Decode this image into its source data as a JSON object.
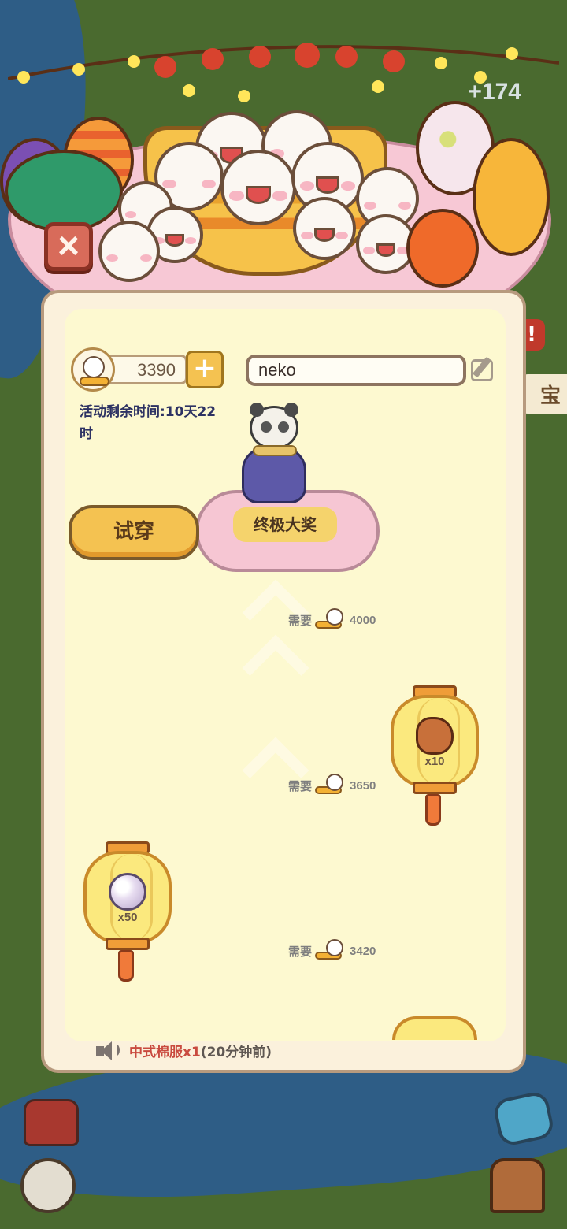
{
  "background": {
    "plus_counter": "+174",
    "side_label": "宝",
    "side_alert": "!"
  },
  "currency": {
    "icon": "tangyuan-coin-icon",
    "amount": "3390",
    "add_icon": "plus-icon"
  },
  "profile": {
    "name_value": "neko",
    "edit_icon": "pencil-edit-icon"
  },
  "event": {
    "timer_text": "活动剩余时间:10天22时"
  },
  "grand_prize": {
    "label": "终极大奖",
    "try_on_label": "试穿"
  },
  "milestones": [
    {
      "require_label": "需要",
      "cost": "4000"
    },
    {
      "require_label": "需要",
      "cost": "3650",
      "reward_item": "roast-meat-icon",
      "reward_qty": "x10"
    },
    {
      "require_label": "需要",
      "cost": "3420",
      "reward_item": "pearl-icon",
      "reward_qty": "x50"
    }
  ],
  "ticker": {
    "icon": "speaker-icon",
    "item": "中式棉服x1",
    "time": "(20分钟前)"
  },
  "colors": {
    "panel_bg": "#fbf1dc",
    "panel_inner": "#fdf9d0",
    "button_yellow": "#f4c251",
    "cloth_pink": "#f7c8d5",
    "close_red": "#d86b5a",
    "ticker_red": "#c94a3f"
  }
}
